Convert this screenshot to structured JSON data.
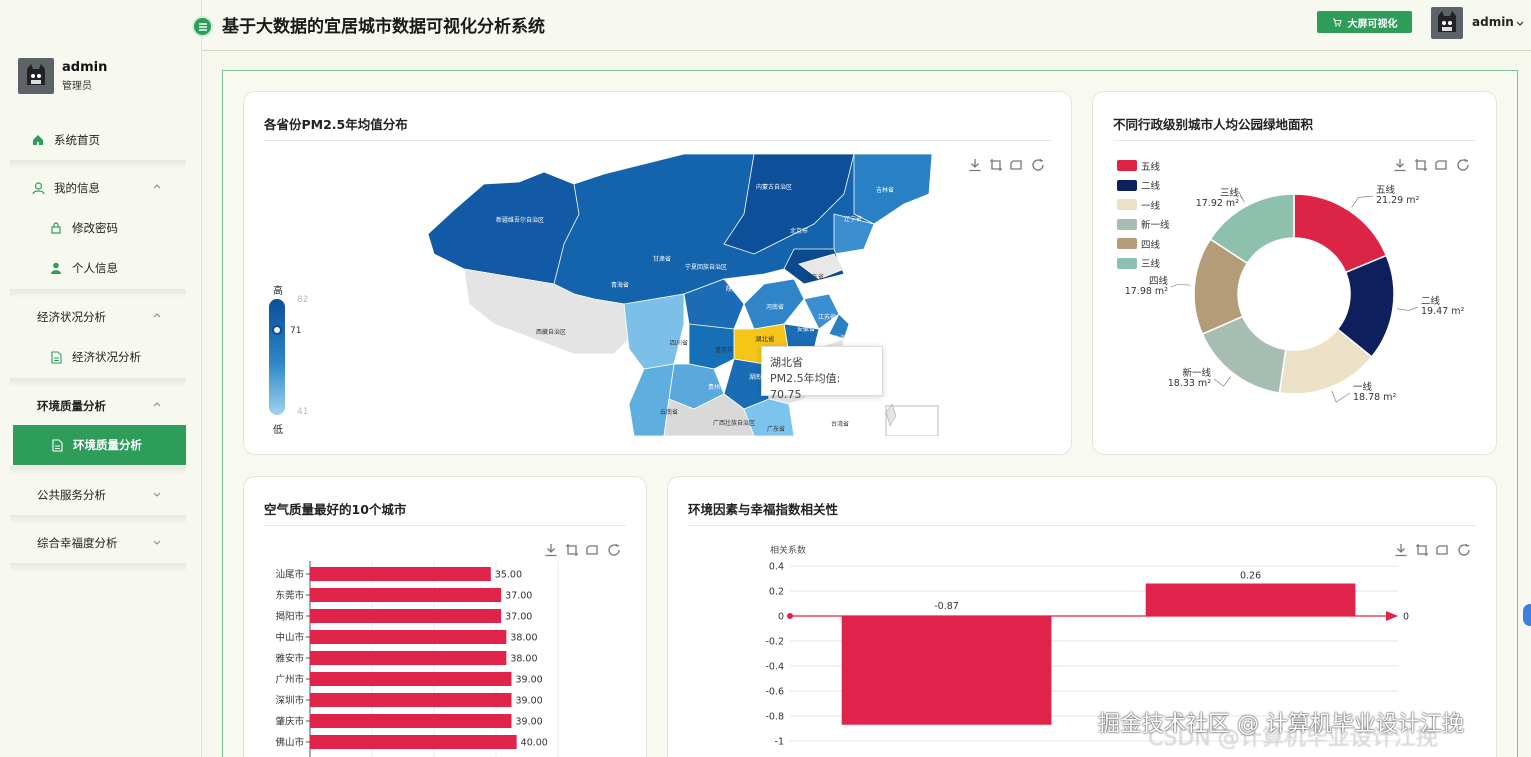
{
  "app": {
    "title": "基于大数据的宜居城市数据可视化分析系统",
    "bigscreen_label": "大屏可视化",
    "user": "admin"
  },
  "sidebar": {
    "user_name": "admin",
    "user_role": "管理员",
    "items": [
      {
        "label": "系统首页",
        "icon": "home-icon"
      },
      {
        "label": "我的信息",
        "icon": "user-icon"
      },
      {
        "label": "修改密码",
        "icon": "lock-icon"
      },
      {
        "label": "个人信息",
        "icon": "person-icon"
      },
      {
        "label": "经济状况分析"
      },
      {
        "label": "经济状况分析",
        "icon": "document-icon"
      },
      {
        "label": "环境质量分析"
      },
      {
        "label": "环境质量分析",
        "icon": "document-icon"
      },
      {
        "label": "公共服务分析"
      },
      {
        "label": "综合幸福度分析"
      }
    ]
  },
  "map_card": {
    "title": "各省份PM2.5年均值分布",
    "visual_map": {
      "high": "高",
      "low": "低",
      "max": "82",
      "min": "41",
      "handle": "71"
    },
    "tooltip": {
      "province": "湖北省",
      "line": "PM2.5年均值: 70.75"
    },
    "labels": [
      "内蒙古自治区",
      "吉林省",
      "辽宁省",
      "新疆维吾尔自治区",
      "甘肃省",
      "宁夏回族自治区",
      "陕西省",
      "青海省",
      "北京市",
      "山东省",
      "河南省",
      "江苏省",
      "安徽省",
      "上海市",
      "湖北省",
      "西藏自治区",
      "四川省",
      "重庆市",
      "贵州省",
      "湖南省",
      "云南省",
      "广西壮族自治区",
      "广东省",
      "台湾省"
    ]
  },
  "donut_card": {
    "title": "不同行政级别城市人均公园绿地面积",
    "legend": [
      {
        "name": "五线",
        "color": "#dc2447"
      },
      {
        "name": "二线",
        "color": "#0d1f5c"
      },
      {
        "name": "一线",
        "color": "#ece0c6"
      },
      {
        "name": "新一线",
        "color": "#a6bdb2"
      },
      {
        "name": "四线",
        "color": "#b59c78"
      },
      {
        "name": "三线",
        "color": "#8ec0ae"
      }
    ],
    "labels": [
      {
        "name": "五线",
        "value": "21.29 m²"
      },
      {
        "name": "二线",
        "value": "19.47 m²"
      },
      {
        "name": "一线",
        "value": "18.78 m²"
      },
      {
        "name": "新一线",
        "value": "18.33 m²"
      },
      {
        "name": "四线",
        "value": "17.98 m²"
      },
      {
        "name": "三线",
        "value": "17.92 m²"
      }
    ]
  },
  "chart_data": [
    {
      "type": "pie",
      "title": "不同行政级别城市人均公园绿地面积",
      "categories": [
        "五线",
        "二线",
        "一线",
        "新一线",
        "四线",
        "三线"
      ],
      "values": [
        21.29,
        19.47,
        18.78,
        18.33,
        17.98,
        17.92
      ],
      "unit": "m²",
      "legend": "top-left"
    },
    {
      "type": "bar",
      "title": "空气质量最好的10个城市",
      "categories": [
        "汕尾市",
        "东莞市",
        "揭阳市",
        "中山市",
        "雅安市",
        "广州市",
        "深圳市",
        "肇庆市",
        "佛山市"
      ],
      "values": [
        35.0,
        37.0,
        37.0,
        38.0,
        38.0,
        39.0,
        39.0,
        39.0,
        40.0
      ],
      "orientation": "horizontal",
      "xlim": [
        0,
        60
      ],
      "color": "#e0234a"
    },
    {
      "type": "bar",
      "title": "环境因素与幸福指数相关性",
      "ylabel": "相关系数",
      "categories": [
        "",
        ""
      ],
      "values": [
        -0.87,
        0.26
      ],
      "ylim": [
        -1,
        0.4
      ],
      "yticks": [
        "0.4",
        "0.2",
        "0",
        "-0.2",
        "-0.4",
        "-0.6",
        "-0.8",
        "-1"
      ],
      "markline": "0",
      "color": "#e0234a"
    }
  ],
  "top10_card": {
    "title": "空气质量最好的10个城市",
    "values_text": [
      "35.00",
      "37.00",
      "37.00",
      "38.00",
      "38.00",
      "39.00",
      "39.00",
      "39.00",
      "40.00"
    ]
  },
  "corr_card": {
    "title": "环境因素与幸福指数相关性",
    "ylabel": "相关系数",
    "bar_labels": [
      "-0.87",
      "0.26"
    ],
    "markline_label": "0"
  },
  "watermark": {
    "line1": "掘金技术社区 @ 计算机毕业设计江挽",
    "line2": "CSDN @计算机毕业设计江挽"
  }
}
